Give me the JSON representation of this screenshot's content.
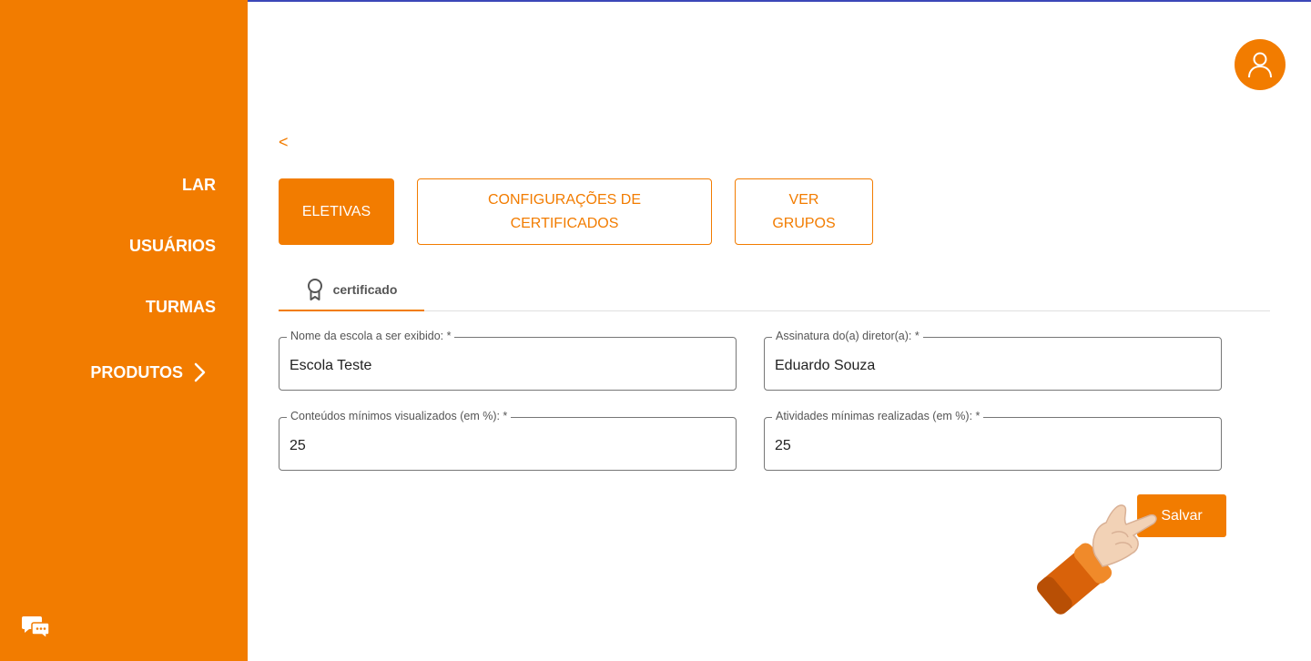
{
  "sidebar": {
    "items": [
      {
        "label": "LAR"
      },
      {
        "label": "USUÁRIOS"
      },
      {
        "label": "TURMAS"
      },
      {
        "label": "PRODUTOS"
      }
    ]
  },
  "header": {
    "back_label": "<"
  },
  "actions": {
    "eletivas_label": "ELETIVAS",
    "config_label": "CONFIGURAÇÕES DE CERTIFICADOS",
    "grupos_label": "VER GRUPOS"
  },
  "tabs": [
    {
      "label": "certificado",
      "icon": "award-ribbon-icon"
    }
  ],
  "form": {
    "school_name": {
      "label": "Nome da escola a ser exibido: *",
      "value": "Escola Teste"
    },
    "director_signature": {
      "label": "Assinatura do(a) diretor(a): *",
      "value": "Eduardo Souza"
    },
    "min_contents": {
      "label": "Conteúdos mínimos visualizados (em %): *",
      "value": "25"
    },
    "min_activities": {
      "label": "Atividades mínimas realizadas (em %): *",
      "value": "25"
    },
    "save_label": "Salvar"
  },
  "colors": {
    "accent": "#f27c00",
    "top_line": "#3b47b8"
  }
}
